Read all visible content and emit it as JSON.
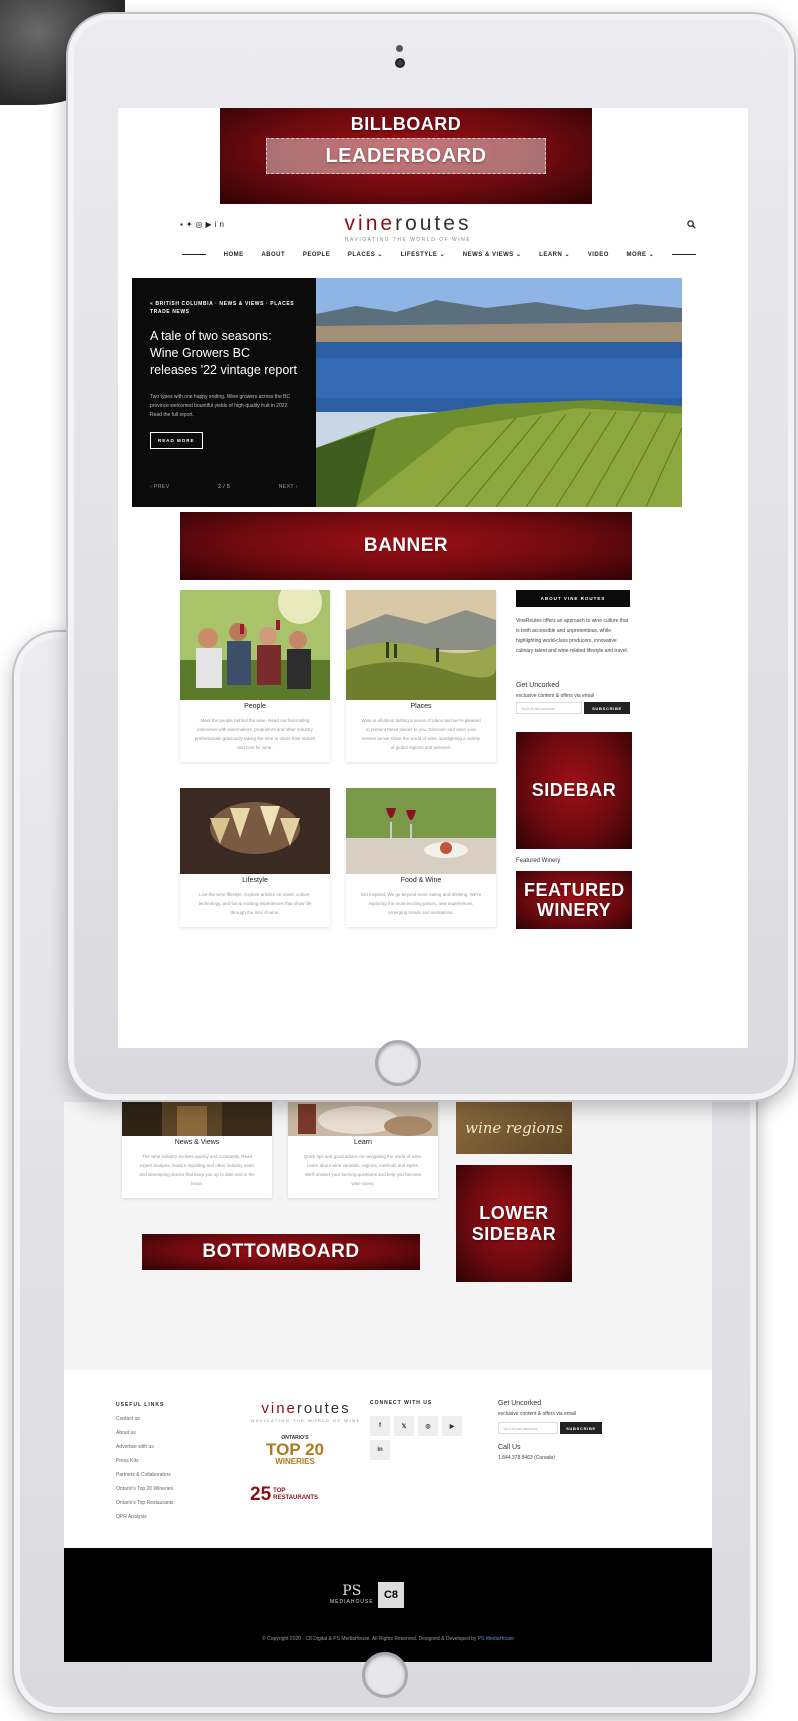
{
  "ads": {
    "billboard": "BILLBOARD",
    "leaderboard": "LEADERBOARD",
    "banner": "BANNER",
    "sidebar": "SIDEBAR",
    "featured_winery": "FEATURED WINERY",
    "lower_sidebar": "LOWER SIDEBAR",
    "bottomboard": "BOTTOMBOARD"
  },
  "header": {
    "social_icons": [
      "facebook-icon",
      "twitter-icon",
      "instagram-icon",
      "youtube-icon",
      "linkedin-icon"
    ],
    "logo_vine": "vine",
    "logo_routes": "routes",
    "logo_tagline": "NAVIGATING THE WORLD OF WINE"
  },
  "nav": {
    "items": [
      "HOME",
      "ABOUT",
      "PEOPLE",
      "PLACES ⌄",
      "LIFESTYLE ⌄",
      "NEWS & VIEWS ⌄",
      "LEARN ⌄",
      "VIDEO",
      "MORE ⌄"
    ]
  },
  "hero": {
    "crumb": "« BRITISH COLUMBIA · NEWS & VIEWS · PLACES TRADE NEWS",
    "title": "A tale of two seasons: Wine Growers BC releases '22 vintage report",
    "description": "Two types with one happy ending. Wine growers across the BC province welcomed bountiful yields of high-quality fruit in 2022. Read the full report.",
    "read_more": "READ MORE",
    "prev": "‹ PREV",
    "page": "2 / 5",
    "next": "NEXT ›"
  },
  "cards": [
    {
      "title": "People",
      "text": "Meet the people behind the wine. Read our fascinating interviews with winemakers, proprietors and other industry professionals graciously taking the time to share their stories and love for wine."
    },
    {
      "title": "Places",
      "text": "Wine is all about tasting a sense of place and we're pleased to present these places to you. Discover and open your senses as we share the world of wine, spotlighting a variety of global regions and wineries."
    },
    {
      "title": "Lifestyle",
      "text": "Live the wine lifestyle. Explore articles on travel, culture, technology, and fun & exciting experiences that show life through the lens of wine."
    },
    {
      "title": "Food & Wine",
      "text": "Get inspired. We go beyond mere eating and drinking. We're exploring the most exciting pieces, new experiences, emerging trends and sensations."
    }
  ],
  "sidebar": {
    "about_title": "ABOUT VINE ROUTES",
    "about_text": "VineRoutes offers an approach to wine culture that is both accessible and unpretentious, while highlighting world-class producers, innovative culinary talent and wine-related lifestyle and travel.",
    "uncorked_title": "Get Uncorked",
    "uncorked_sub": "exclusive content & offers via email",
    "email_placeholder": "Your email address",
    "subscribe": "SUBSCRIBE",
    "featured_label": "Featured Winery",
    "lower_image_text": "wine regions"
  },
  "lower_cards": [
    {
      "title": "News & Views",
      "text": "The wine industry evolves quickly and constantly. Read expert analysis, feature reporting and other industry news and developing stories that keep you up to date and in the know."
    },
    {
      "title": "Learn",
      "text": "Quick tips and good advice on navigating the world of wine. Learn about wine varietals, regions, methods and styles. We'll answer your burning questions and help you become wine savvy."
    }
  ],
  "footer": {
    "useful_links_title": "USEFUL LINKS",
    "links": [
      "Contact us",
      "About us",
      "Advertise with us",
      "Press Kits",
      "Partners & Collaborators",
      "Ontario's Top 20 Wineries",
      "Ontario's Top Restaurants",
      "QPR Analysis"
    ],
    "top20_line1": "ONTARIO'S",
    "top20_line2": "TOP 20",
    "top20_line3": "WINERIES",
    "top25_num": "25",
    "top25_line1": "TOP",
    "top25_line2": "RESTAURANTS",
    "connect_title": "CONNECT WITH US",
    "social": [
      "f",
      "𝕏",
      "◎",
      "▶",
      "in"
    ],
    "uncorked_title": "Get Uncorked",
    "uncorked_sub": "exclusive content & offers via email",
    "email_placeholder": "Your email address",
    "subscribe": "SUBSCRIBE",
    "call_title": "Call Us",
    "phone": "1.844.378.8463 (Canada)",
    "ps_logo": "PS",
    "ps_sub": "MEDIAHOUSE",
    "c8_logo": "C8",
    "copyright_main": "© Copyright 2020 - C8 Digital & PS MediaHouse. All Rights Reserved. Designed & Developed by ",
    "copyright_link": "PS MediaHouse"
  }
}
